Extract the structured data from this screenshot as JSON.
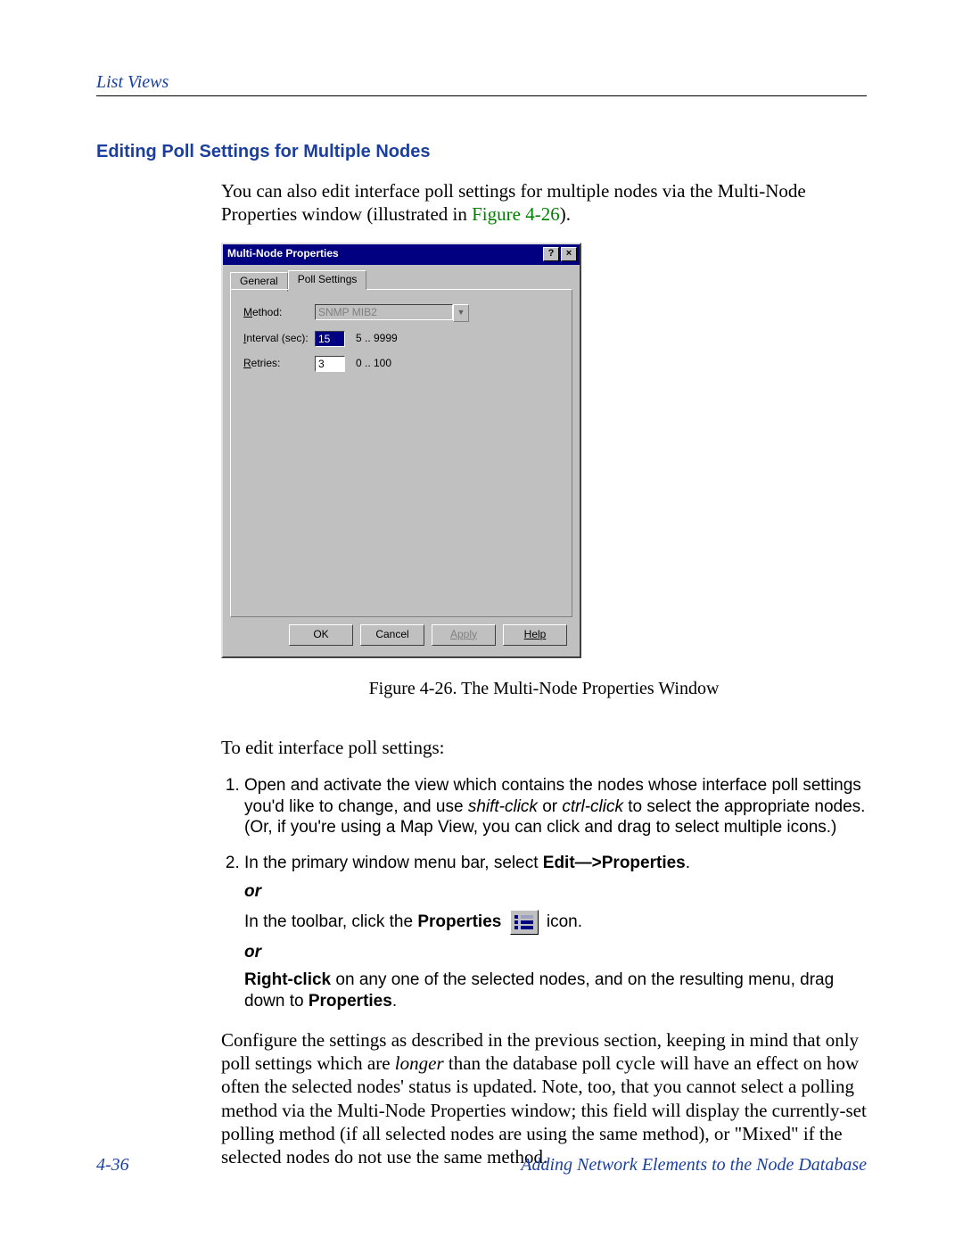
{
  "page": {
    "running_head": "List Views",
    "section_title": "Editing Poll Settings for Multiple Nodes",
    "intro_part1": "You can also edit interface poll settings for multiple nodes via the Multi-Node Properties window (illustrated in ",
    "intro_figref": "Figure 4-26",
    "intro_part2": ").",
    "figure_caption": "Figure 4-26.  The Multi-Node Properties Window",
    "lead_in": "To edit interface poll settings:",
    "step1": "Open and activate the view which contains the nodes whose interface poll settings you'd like to change, and use shift-click or ctrl-click to select the appropriate nodes. (Or, if you're using a Map View, you can click and drag to select multiple icons.)",
    "step2_pre": "In the primary window menu bar, select ",
    "step2_bold": "Edit—>Properties",
    "step2_post": ".",
    "or_label": "or",
    "step2_alt1_pre": "In the toolbar, click the ",
    "step2_alt1_bold": "Properties",
    "step2_alt1_post": "  icon.",
    "step2_alt2_bold1": "Right-click",
    "step2_alt2_mid": " on any one of the selected nodes, and on the resulting menu, drag down to ",
    "step2_alt2_bold2": "Properties",
    "step2_alt2_post": ".",
    "closing": "Configure the settings as described in the previous section, keeping in mind that only poll settings which are longer than the database poll cycle will have an effect on how often the selected nodes' status is updated. Note, too, that you cannot select a polling method via the Multi-Node Properties window; this field will display the currently-set polling method (if all selected nodes are using the same method), or \"Mixed\" if the selected nodes do not use the same method.",
    "footer_left": "4-36",
    "footer_right": "Adding Network Elements to the Node Database"
  },
  "dialog": {
    "title": "Multi-Node Properties",
    "tabs": {
      "general": "General",
      "poll": "Poll Settings"
    },
    "fields": {
      "method_label": "Method:",
      "method_value": "SNMP MIB2",
      "interval_label": "Interval (sec):",
      "interval_value": "15",
      "interval_range": "5 .. 9999",
      "retries_label": "Retries:",
      "retries_value": "3",
      "retries_range": "0 .. 100"
    },
    "buttons": {
      "ok": "OK",
      "cancel": "Cancel",
      "apply": "Apply",
      "help": "Help"
    }
  }
}
